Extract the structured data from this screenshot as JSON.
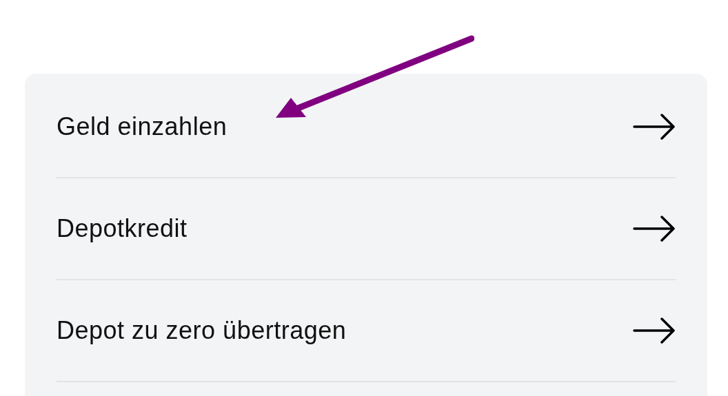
{
  "menu": {
    "items": [
      {
        "label": "Geld einzahlen"
      },
      {
        "label": "Depotkredit"
      },
      {
        "label": "Depot zu zero übertragen"
      }
    ]
  }
}
